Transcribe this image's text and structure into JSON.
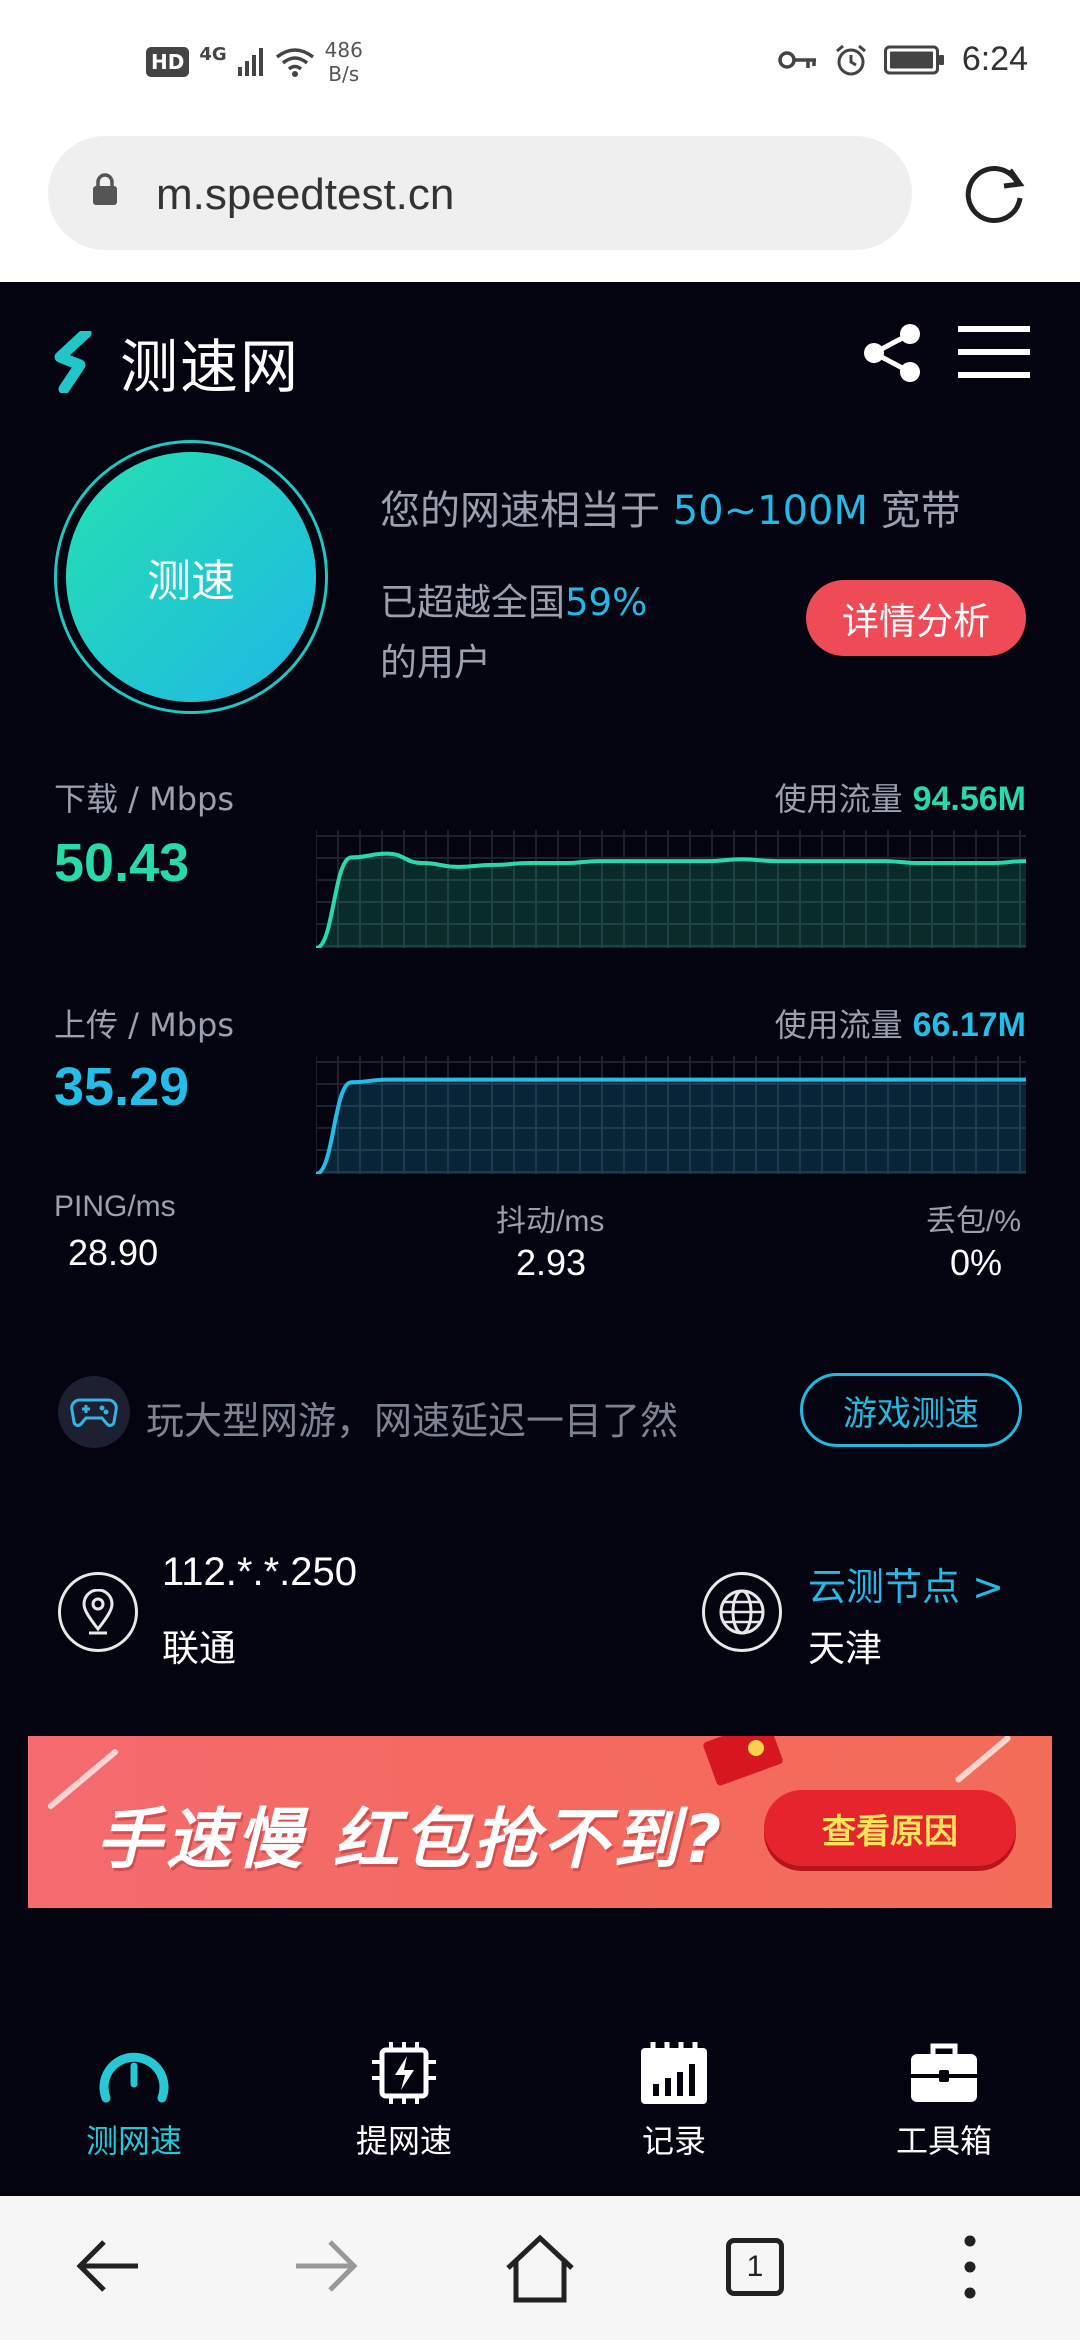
{
  "status_bar": {
    "hd": "HD",
    "network": "4G",
    "net_speed_value": "486",
    "net_speed_unit": "B/s",
    "time": "6:24"
  },
  "browser": {
    "url": "m.speedtest.cn"
  },
  "header": {
    "logo_text": "测速网"
  },
  "test": {
    "button_label": "测速",
    "equiv_prefix": "您的网速相当于 ",
    "equiv_value": "50~100M",
    "equiv_suffix": " 宽带",
    "beat_prefix": "已超越全国",
    "beat_percent": "59%",
    "beat_suffix": "的用户",
    "detail_button": "详情分析"
  },
  "download": {
    "label": "下载 / Mbps",
    "value": "50.43",
    "traffic_label": "使用流量",
    "traffic_value": "94.56M",
    "color": "#27dba6",
    "curve": [
      0,
      48,
      50,
      45,
      43,
      44,
      45,
      45,
      46,
      46,
      46,
      46,
      47,
      46,
      46,
      46,
      46,
      45,
      45,
      45,
      46
    ]
  },
  "upload": {
    "label": "上传 / Mbps",
    "value": "35.29",
    "traffic_label": "使用流量",
    "traffic_value": "66.17M",
    "color": "#24bde8",
    "curve": [
      0,
      34,
      35,
      35,
      35,
      35,
      35,
      35,
      35,
      35,
      35,
      35,
      35,
      35,
      35,
      35,
      35,
      35,
      35,
      35,
      35
    ]
  },
  "stats": {
    "ping_label": "PING/ms",
    "ping_value": "28.90",
    "jitter_label": "抖动/ms",
    "jitter_value": "2.93",
    "loss_label": "丢包/%",
    "loss_value": "0%"
  },
  "game": {
    "text": "玩大型网游，网速延迟一目了然",
    "button": "游戏测速"
  },
  "connection": {
    "ip": "112.*.*.250",
    "isp": "联通",
    "node_link": "云测节点 >",
    "node_city": "天津"
  },
  "banner": {
    "title": "手速慢 红包抢不到?",
    "button": "查看原因"
  },
  "app_nav": {
    "items": [
      {
        "label": "测网速",
        "icon": "speedometer-icon",
        "active": true
      },
      {
        "label": "提网速",
        "icon": "chip-boost-icon",
        "active": false
      },
      {
        "label": "记录",
        "icon": "calendar-chart-icon",
        "active": false
      },
      {
        "label": "工具箱",
        "icon": "toolbox-icon",
        "active": false
      }
    ],
    "active_color": "#27c8d6"
  },
  "system_nav": {
    "tab_count": "1"
  }
}
